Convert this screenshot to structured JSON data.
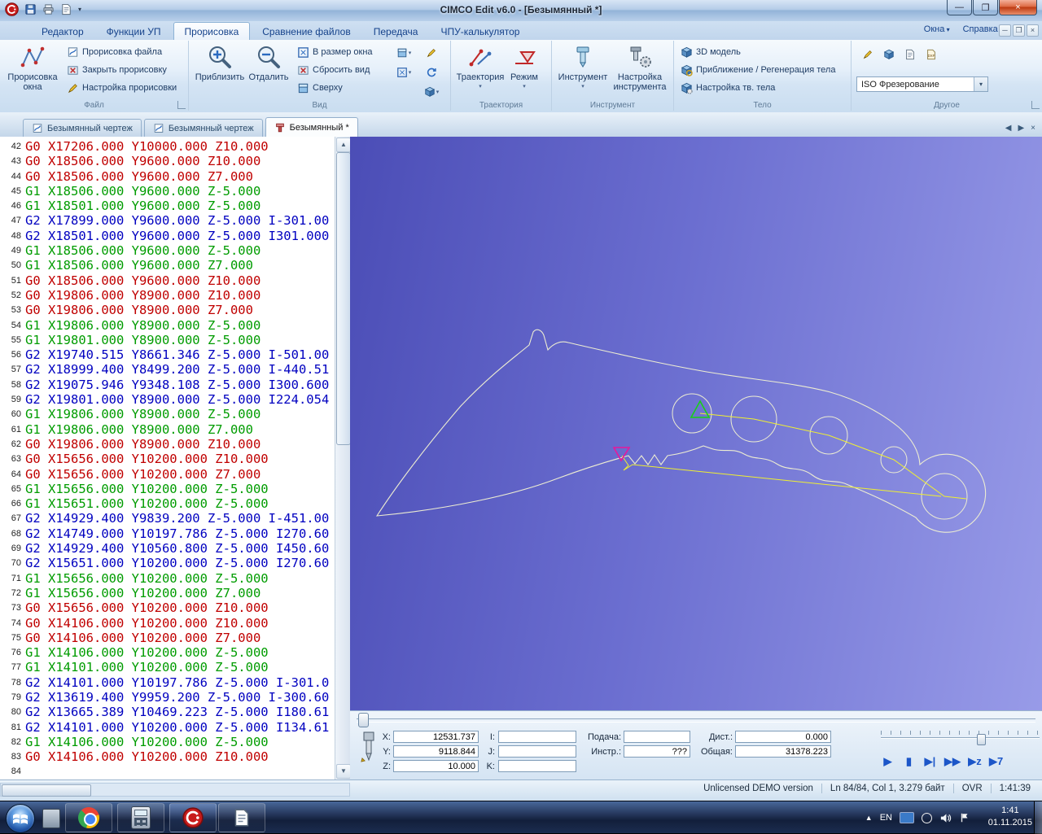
{
  "window": {
    "title": "CIMCO Edit v6.0 - [Безымянный *]",
    "minimize": "—",
    "maximize": "❐",
    "close": "×"
  },
  "ribbon_tabs": [
    {
      "label": "Редактор",
      "active": false
    },
    {
      "label": "Функции УП",
      "active": false
    },
    {
      "label": "Прорисовка",
      "active": true
    },
    {
      "label": "Сравнение файлов",
      "active": false
    },
    {
      "label": "Передача",
      "active": false
    },
    {
      "label": "ЧПУ-калькулятор",
      "active": false
    }
  ],
  "menu_right": {
    "windows": "Окна",
    "help": "Справка"
  },
  "ribbon": {
    "file_group": {
      "label": "Файл",
      "big": "Прорисовка окна",
      "items": [
        "Прорисовка файла",
        "Закрыть прорисовку",
        "Настройка прорисовки"
      ]
    },
    "view_group": {
      "label": "Вид",
      "zoom_in": "Приблизить",
      "zoom_out": "Отдалить",
      "fit": "В размер окна",
      "reset": "Сбросить вид",
      "top": "Сверху"
    },
    "path_group": {
      "label": "Траектория",
      "traj": "Траектория",
      "mode": "Режим"
    },
    "tool_group": {
      "label": "Инструмент",
      "tool": "Инструмент",
      "setup": "Настройка инструмента"
    },
    "solid_group": {
      "label": "Тело",
      "items": [
        "3D модель",
        "Приближение / Регенерация тела",
        "Настройка тв. тела"
      ]
    },
    "other_group": {
      "label": "Другое",
      "dropdown": "ISO Фрезерование",
      "dxf": "DXF"
    }
  },
  "doc_tabs": [
    {
      "label": "Безымянный чертеж",
      "icon": "draw",
      "active": false
    },
    {
      "label": "Безымянный чертеж",
      "icon": "draw",
      "active": false
    },
    {
      "label": "Безымянный *",
      "icon": "tool",
      "active": true
    }
  ],
  "code": {
    "lines": [
      {
        "n": 42,
        "cls": "g0",
        "text": "G0 X17206.000 Y10000.000 Z10.000"
      },
      {
        "n": 43,
        "cls": "g0",
        "text": "G0 X18506.000 Y9600.000 Z10.000"
      },
      {
        "n": 44,
        "cls": "g0",
        "text": "G0 X18506.000 Y9600.000 Z7.000"
      },
      {
        "n": 45,
        "cls": "g1",
        "text": "G1 X18506.000 Y9600.000 Z-5.000"
      },
      {
        "n": 46,
        "cls": "g1",
        "text": "G1 X18501.000 Y9600.000 Z-5.000"
      },
      {
        "n": 47,
        "cls": "g2",
        "text": "G2 X17899.000 Y9600.000 Z-5.000 I-301.00"
      },
      {
        "n": 48,
        "cls": "g2",
        "text": "G2 X18501.000 Y9600.000 Z-5.000 I301.000"
      },
      {
        "n": 49,
        "cls": "g1",
        "text": "G1 X18506.000 Y9600.000 Z-5.000"
      },
      {
        "n": 50,
        "cls": "g1",
        "text": "G1 X18506.000 Y9600.000 Z7.000"
      },
      {
        "n": 51,
        "cls": "g0",
        "text": "G0 X18506.000 Y9600.000 Z10.000"
      },
      {
        "n": 52,
        "cls": "g0",
        "text": "G0 X19806.000 Y8900.000 Z10.000"
      },
      {
        "n": 53,
        "cls": "g0",
        "text": "G0 X19806.000 Y8900.000 Z7.000"
      },
      {
        "n": 54,
        "cls": "g1",
        "text": "G1 X19806.000 Y8900.000 Z-5.000"
      },
      {
        "n": 55,
        "cls": "g1",
        "text": "G1 X19801.000 Y8900.000 Z-5.000"
      },
      {
        "n": 56,
        "cls": "g2",
        "text": "G2 X19740.515 Y8661.346 Z-5.000 I-501.00"
      },
      {
        "n": 57,
        "cls": "g2",
        "text": "G2 X18999.400 Y8499.200 Z-5.000 I-440.51"
      },
      {
        "n": 58,
        "cls": "g2",
        "text": "G2 X19075.946 Y9348.108 Z-5.000 I300.600"
      },
      {
        "n": 59,
        "cls": "g2",
        "text": "G2 X19801.000 Y8900.000 Z-5.000 I224.054"
      },
      {
        "n": 60,
        "cls": "g1",
        "text": "G1 X19806.000 Y8900.000 Z-5.000"
      },
      {
        "n": 61,
        "cls": "g1",
        "text": "G1 X19806.000 Y8900.000 Z7.000"
      },
      {
        "n": 62,
        "cls": "g0",
        "text": "G0 X19806.000 Y8900.000 Z10.000"
      },
      {
        "n": 63,
        "cls": "g0",
        "text": "G0 X15656.000 Y10200.000 Z10.000"
      },
      {
        "n": 64,
        "cls": "g0",
        "text": "G0 X15656.000 Y10200.000 Z7.000"
      },
      {
        "n": 65,
        "cls": "g1",
        "text": "G1 X15656.000 Y10200.000 Z-5.000"
      },
      {
        "n": 66,
        "cls": "g1",
        "text": "G1 X15651.000 Y10200.000 Z-5.000"
      },
      {
        "n": 67,
        "cls": "g2",
        "text": "G2 X14929.400 Y9839.200 Z-5.000 I-451.00"
      },
      {
        "n": 68,
        "cls": "g2",
        "text": "G2 X14749.000 Y10197.786 Z-5.000 I270.60"
      },
      {
        "n": 69,
        "cls": "g2",
        "text": "G2 X14929.400 Y10560.800 Z-5.000 I450.60"
      },
      {
        "n": 70,
        "cls": "g2",
        "text": "G2 X15651.000 Y10200.000 Z-5.000 I270.60"
      },
      {
        "n": 71,
        "cls": "g1",
        "text": "G1 X15656.000 Y10200.000 Z-5.000"
      },
      {
        "n": 72,
        "cls": "g1",
        "text": "G1 X15656.000 Y10200.000 Z7.000"
      },
      {
        "n": 73,
        "cls": "g0",
        "text": "G0 X15656.000 Y10200.000 Z10.000"
      },
      {
        "n": 74,
        "cls": "g0",
        "text": "G0 X14106.000 Y10200.000 Z10.000"
      },
      {
        "n": 75,
        "cls": "g0",
        "text": "G0 X14106.000 Y10200.000 Z7.000"
      },
      {
        "n": 76,
        "cls": "g1",
        "text": "G1 X14106.000 Y10200.000 Z-5.000"
      },
      {
        "n": 77,
        "cls": "g1",
        "text": "G1 X14101.000 Y10200.000 Z-5.000"
      },
      {
        "n": 78,
        "cls": "g2",
        "text": "G2 X14101.000 Y10197.786 Z-5.000 I-301.0"
      },
      {
        "n": 79,
        "cls": "g2",
        "text": "G2 X13619.400 Y9959.200 Z-5.000 I-300.60"
      },
      {
        "n": 80,
        "cls": "g2",
        "text": "G2 X13665.389 Y10469.223 Z-5.000 I180.61"
      },
      {
        "n": 81,
        "cls": "g2",
        "text": "G2 X14101.000 Y10200.000 Z-5.000 I134.61"
      },
      {
        "n": 82,
        "cls": "g1",
        "text": "G1 X14106.000 Y10200.000 Z-5.000"
      },
      {
        "n": 83,
        "cls": "g0",
        "text": "G0 X14106.000 Y10200.000 Z10.000"
      },
      {
        "n": 84,
        "cls": "",
        "text": ""
      }
    ]
  },
  "plot_controls": {
    "x_label": "X:",
    "x_value": "12531.737",
    "y_label": "Y:",
    "y_value": "9118.844",
    "z_label": "Z:",
    "z_value": "10.000",
    "i_label": "I:",
    "i_value": "",
    "j_label": "J:",
    "j_value": "",
    "k_label": "K:",
    "k_value": "",
    "feed_label": "Подача:",
    "feed_value": "",
    "tool_label": "Инстр.:",
    "tool_value": "???",
    "dist_label": "Дист.:",
    "dist_value": "0.000",
    "total_label": "Общая:",
    "total_value": "31378.223"
  },
  "playback": [
    {
      "name": "play-button",
      "glyph": "▶"
    },
    {
      "name": "stop-button",
      "glyph": "▮"
    },
    {
      "name": "step-button",
      "glyph": "▶|"
    },
    {
      "name": "fast-forward-button",
      "glyph": "▶▶"
    },
    {
      "name": "run-to-z-button",
      "glyph": "▶z"
    },
    {
      "name": "run-to-tool-button",
      "glyph": "▶7"
    }
  ],
  "statusbar": {
    "demo": "Unlicensed DEMO version",
    "position": "Ln 84/84, Col 1, 3.279 байт",
    "ovr": "OVR",
    "time": "1:41:39"
  },
  "taskbar": {
    "lang": "EN",
    "clock_time": "1:41",
    "clock_date": "01.11.2015"
  },
  "colors": {
    "rapid": "#c00000",
    "linear": "#009c00",
    "arc": "#0000c0",
    "plot_rapid_line": "#f0f030"
  }
}
